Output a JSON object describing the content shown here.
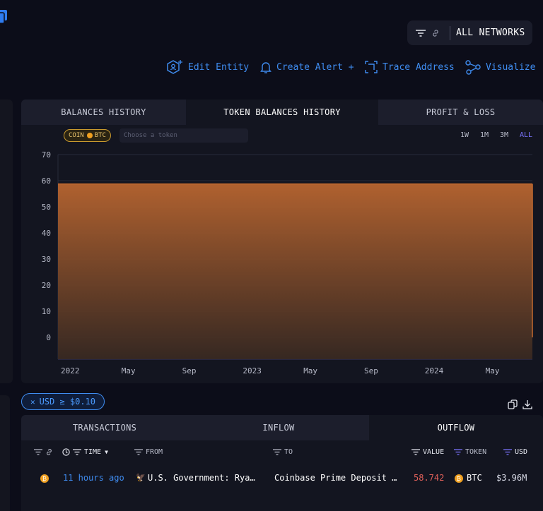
{
  "network": {
    "label": "ALL NETWORKS"
  },
  "actions": [
    {
      "label": "Edit Entity",
      "icon": "hexagon-user-plus-icon"
    },
    {
      "label": "Create Alert +",
      "icon": "bell-icon"
    },
    {
      "label": "Trace Address",
      "icon": "trace-icon"
    },
    {
      "label": "Visualize",
      "icon": "graph-nodes-icon"
    }
  ],
  "chart_tabs": [
    "BALANCES HISTORY",
    "TOKEN BALANCES HISTORY",
    "PROFIT & LOSS"
  ],
  "coin_badge": {
    "prefix": "COIN",
    "symbol": "BTC"
  },
  "token_input": {
    "placeholder": "Choose a token"
  },
  "ranges": [
    "1W",
    "1M",
    "3M",
    "ALL"
  ],
  "colors": {
    "accent": "#3f8cf0",
    "area": "#c2692f",
    "btc": "#f0a020",
    "value": "#e0605a"
  },
  "chart_data": {
    "type": "area",
    "x_ticks": [
      "2022",
      "May",
      "Sep",
      "2023",
      "May",
      "Sep",
      "2024",
      "May"
    ],
    "y_ticks": [
      0,
      10,
      20,
      30,
      40,
      50,
      60,
      70
    ],
    "ylim": [
      0,
      70
    ],
    "series": [
      {
        "x": [
          "2022-01-01",
          "2024-10-01"
        ],
        "values": [
          58.742,
          58.742
        ]
      }
    ],
    "grid": true
  },
  "filter_chip": {
    "label": "USD ≥ $0.10"
  },
  "tx_tabs": [
    "TRANSACTIONS",
    "INFLOW",
    "OUTFLOW"
  ],
  "tx_headers": {
    "time": "TIME",
    "from": "FROM",
    "to": "TO",
    "value": "VALUE",
    "token": "TOKEN",
    "usd": "USD"
  },
  "tx_rows": [
    {
      "time": "11 hours ago",
      "from": "U.S. Government: Rya…",
      "to": "Coinbase Prime Deposit …",
      "value": "58.742",
      "token": "BTC",
      "usd": "$3.96M"
    }
  ]
}
